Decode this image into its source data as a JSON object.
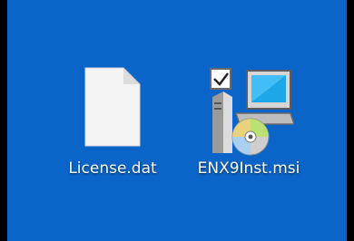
{
  "desktop": {
    "icons": [
      {
        "label": "License.dat",
        "icon": "blank-file-icon"
      },
      {
        "label": "ENX9Inst.msi",
        "icon": "msi-installer-icon"
      }
    ]
  }
}
